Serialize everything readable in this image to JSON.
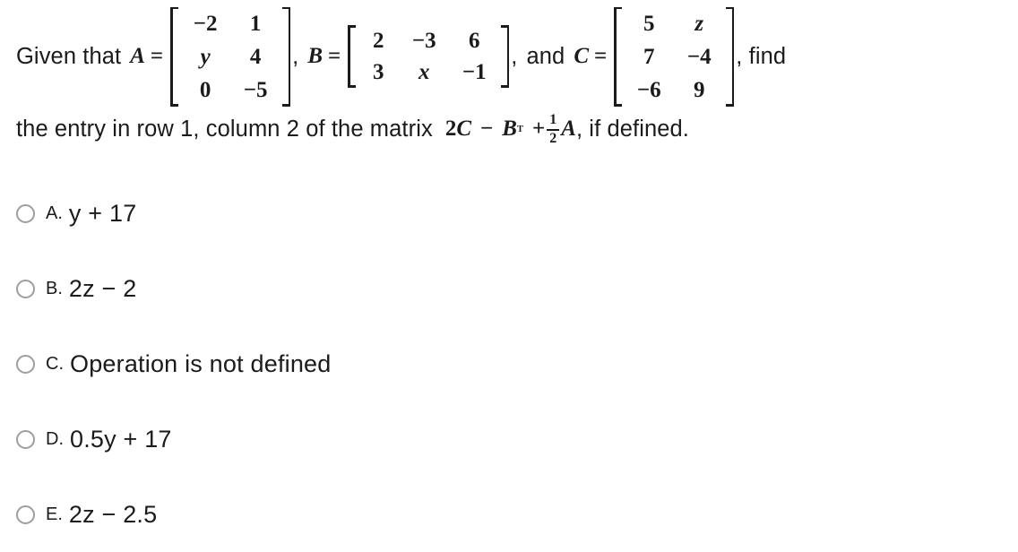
{
  "question": {
    "intro": "Given that",
    "var_a": "A",
    "equals": "=",
    "comma": ",",
    "var_b": "B",
    "conj_and": "and",
    "var_c": "C",
    "tail_find": ", find",
    "line2_lead": "the entry in row 1, column 2 of the matrix",
    "expr_coeff2": "2",
    "expr_c": "C",
    "expr_minus": "−",
    "expr_b": "B",
    "expr_transpose": "T",
    "expr_plus": "+",
    "frac_num": "1",
    "frac_den": "2",
    "expr_a": "A",
    "line2_tail": ", if defined."
  },
  "matrices": {
    "A": {
      "name": "A",
      "rows": 3,
      "cols": 2,
      "cells": [
        [
          "−2",
          "1"
        ],
        [
          "y",
          "4"
        ],
        [
          "0",
          "−5"
        ]
      ],
      "italic_cells": [
        "y"
      ]
    },
    "B": {
      "name": "B",
      "rows": 2,
      "cols": 3,
      "cells": [
        [
          "2",
          "−3",
          "6"
        ],
        [
          "3",
          "x",
          "−1"
        ]
      ],
      "italic_cells": [
        "x"
      ]
    },
    "C": {
      "name": "C",
      "rows": 3,
      "cols": 2,
      "cells": [
        [
          "5",
          "z"
        ],
        [
          "7",
          "−4"
        ],
        [
          "−6",
          "9"
        ]
      ],
      "italic_cells": [
        "z"
      ]
    }
  },
  "options": [
    {
      "letter": "A.",
      "text": "y + 17"
    },
    {
      "letter": "B.",
      "text": "2z − 2"
    },
    {
      "letter": "C.",
      "text": "Operation is not defined"
    },
    {
      "letter": "D.",
      "text": "0.5y + 17"
    },
    {
      "letter": "E.",
      "text": "2z − 2.5"
    }
  ],
  "colors": {
    "text": "#1b1b1b",
    "radio_border": "#9e9e9e",
    "background": "#ffffff"
  }
}
